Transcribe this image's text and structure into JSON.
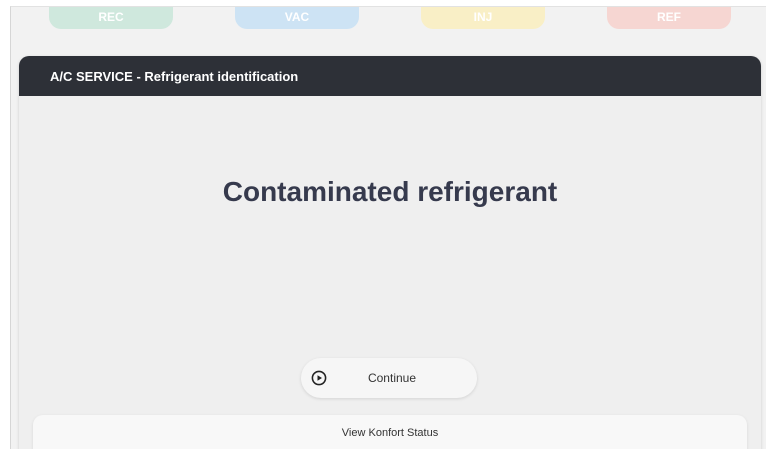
{
  "steps": [
    {
      "label": "REC",
      "color": "#cfe8dd"
    },
    {
      "label": "VAC",
      "color": "#cde3f4"
    },
    {
      "label": "INJ",
      "color": "#f9efc6"
    },
    {
      "label": "REF",
      "color": "#f6d6d2"
    }
  ],
  "panel": {
    "title": "A/C SERVICE - Refrigerant identification",
    "header_color": "#2d3037",
    "message": "Contaminated refrigerant",
    "message_color": "#363a4d"
  },
  "actions": {
    "continue_label": "Continue",
    "continue_icon": "play-circle-icon",
    "status_label": "View Konfort Status"
  }
}
